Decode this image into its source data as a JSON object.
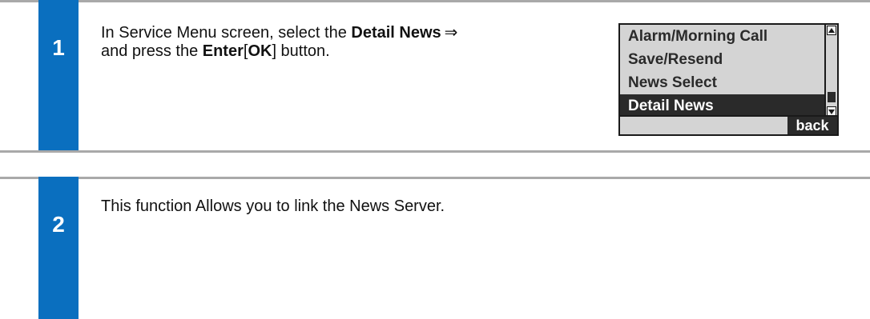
{
  "steps": [
    {
      "number": "1",
      "line1_prefix": "In Service Menu screen, select the ",
      "line1_bold": "Detail News",
      "arrow": "⇒",
      "line2_prefix": "and press the ",
      "line2_bold1": "Enter",
      "line2_bracket_open": "[",
      "line2_bold2": "OK",
      "line2_suffix": "] button."
    },
    {
      "number": "2",
      "text": "This function Allows you to link the News Server."
    }
  ],
  "lcd": {
    "items": [
      "Alarm/Morning Call",
      "Save/Resend",
      "News Select",
      "Detail News"
    ],
    "selected_index": 3,
    "softkey": "back"
  },
  "colors": {
    "accent": "#0a6fbf",
    "rule": "#a9a9a9",
    "lcd_bg": "#d4d4d4",
    "lcd_dark": "#2a2a2a"
  }
}
